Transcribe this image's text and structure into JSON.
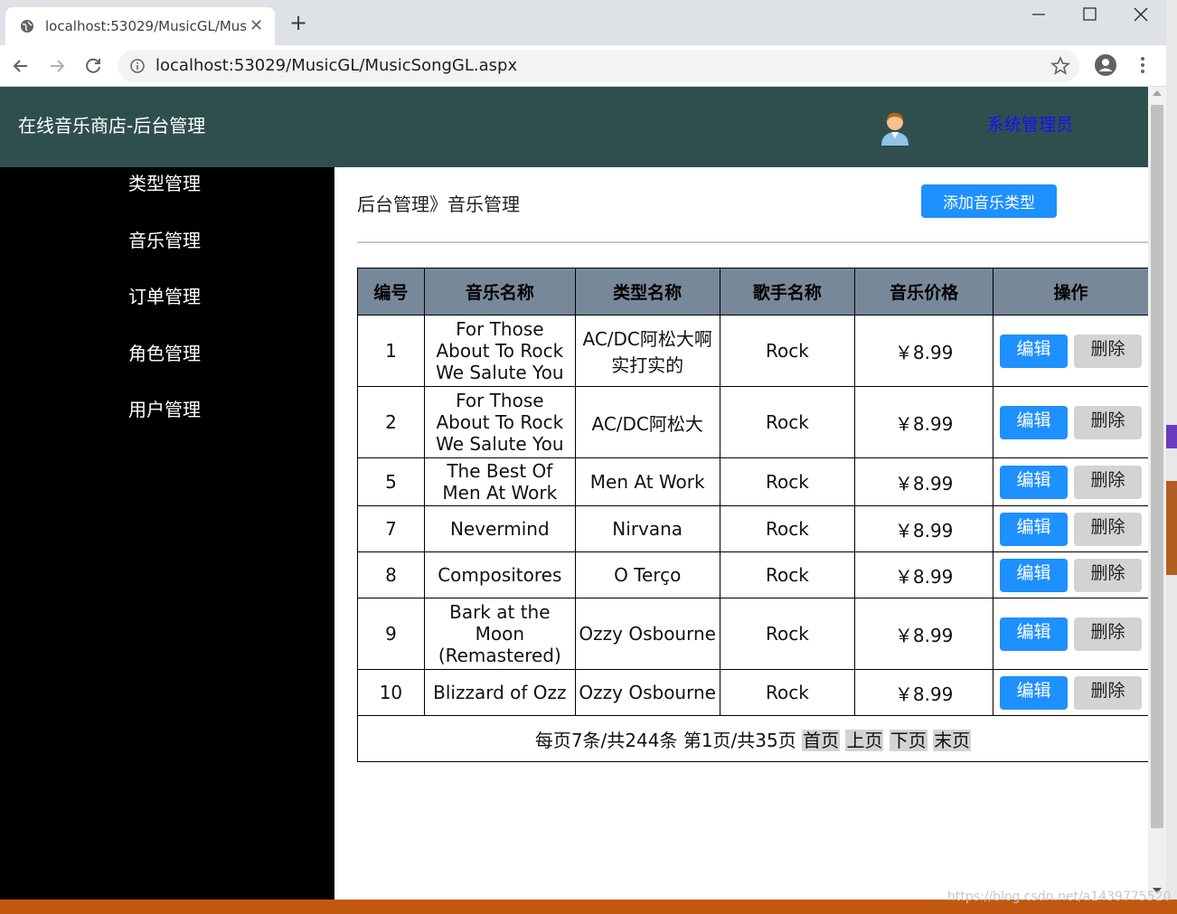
{
  "browser": {
    "tab_title": "localhost:53029/MusicGL/Mus",
    "url": "localhost:53029/MusicGL/MusicSongGL.aspx"
  },
  "header": {
    "site_title": "在线音乐商店-后台管理",
    "admin_label": "系统管理员"
  },
  "sidebar": {
    "items": [
      {
        "label": "类型管理"
      },
      {
        "label": "音乐管理"
      },
      {
        "label": "订单管理"
      },
      {
        "label": "角色管理"
      },
      {
        "label": "用户管理"
      }
    ]
  },
  "main": {
    "breadcrumb": "后台管理》音乐管理",
    "add_button": "添加音乐类型"
  },
  "table": {
    "headers": [
      "编号",
      "音乐名称",
      "类型名称",
      "歌手名称",
      "音乐价格",
      "操作"
    ],
    "rows": [
      {
        "id": "1",
        "name": "For Those About To Rock We Salute You",
        "type": "AC/DC阿松大啊实打实的",
        "singer": "Rock",
        "price": "￥8.99",
        "edit": "编辑",
        "delete": "删除"
      },
      {
        "id": "2",
        "name": "For Those About To Rock We Salute You",
        "type": "AC/DC阿松大",
        "singer": "Rock",
        "price": "￥8.99",
        "edit": "编辑",
        "delete": "删除"
      },
      {
        "id": "5",
        "name": "The Best Of Men At Work",
        "type": "Men At Work",
        "singer": "Rock",
        "price": "￥8.99",
        "edit": "编辑",
        "delete": "删除"
      },
      {
        "id": "7",
        "name": "Nevermind",
        "type": "Nirvana",
        "singer": "Rock",
        "price": "￥8.99",
        "edit": "编辑",
        "delete": "删除"
      },
      {
        "id": "8",
        "name": "Compositores",
        "type": "O Terço",
        "singer": "Rock",
        "price": "￥8.99",
        "edit": "编辑",
        "delete": "删除"
      },
      {
        "id": "9",
        "name": "Bark at the Moon (Remastered)",
        "type": "Ozzy Osbourne",
        "singer": "Rock",
        "price": "￥8.99",
        "edit": "编辑",
        "delete": "删除"
      },
      {
        "id": "10",
        "name": "Blizzard of Ozz",
        "type": "Ozzy Osbourne",
        "singer": "Rock",
        "price": "￥8.99",
        "edit": "编辑",
        "delete": "删除"
      }
    ],
    "pager": {
      "summary": "每页7条/共244条 第1页/共35页",
      "first": "首页",
      "prev": "上页",
      "next": "下页",
      "last": "末页"
    }
  },
  "watermark": "https://blog.csdn.net/a1439775520",
  "colors": {
    "header_bg": "#2f4f4f",
    "sidebar_bg": "#000000",
    "table_header_bg": "#778899",
    "primary_button": "#1e90ff",
    "secondary_button": "#d3d3d3",
    "admin_link": "#1a0dff"
  }
}
